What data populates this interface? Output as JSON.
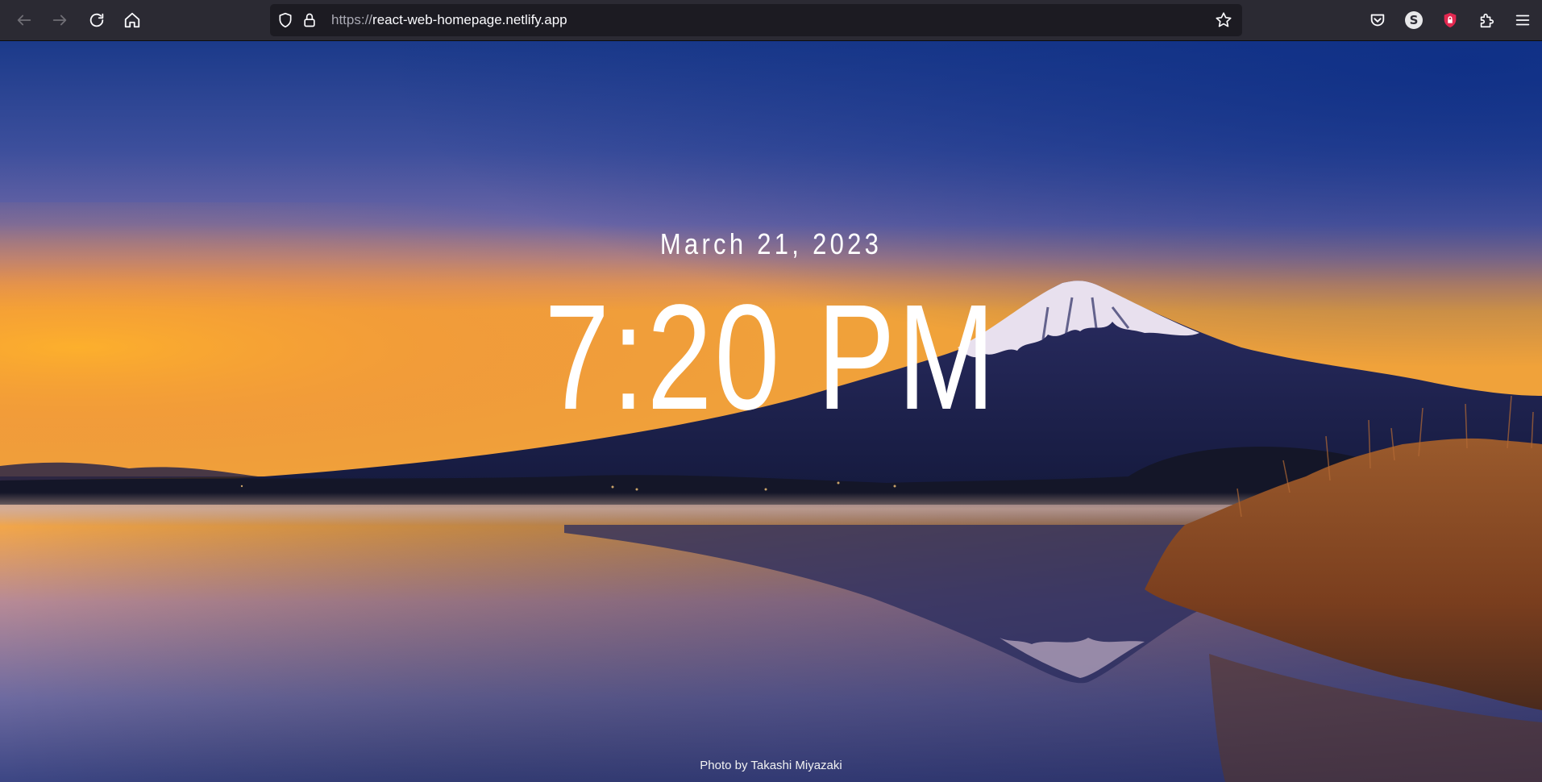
{
  "browser": {
    "url_scheme": "https://",
    "url_host": "react-web-homepage.netlify.app",
    "extension_badge": "S",
    "icons": [
      "back-arrow-icon",
      "forward-arrow-icon",
      "reload-icon",
      "home-icon",
      "tracking-shield-icon",
      "lock-icon",
      "bookmark-star-icon",
      "pocket-icon",
      "s-extension-icon",
      "ublock-icon",
      "extensions-puzzle-icon",
      "hamburger-menu-icon"
    ]
  },
  "page": {
    "date": "March 21, 2023",
    "time": "7:20 PM",
    "photo_credit": "Photo by Takashi Miyazaki"
  },
  "colors": {
    "toolbar_bg": "#2b2a33",
    "urlbar_bg": "#1c1b22",
    "sky_top": "#1b3a8a",
    "horizon_glow": "#f4a12a",
    "mountain": "#1f2250",
    "snow": "#e9e4f0",
    "reeds": "#8a4a22"
  }
}
